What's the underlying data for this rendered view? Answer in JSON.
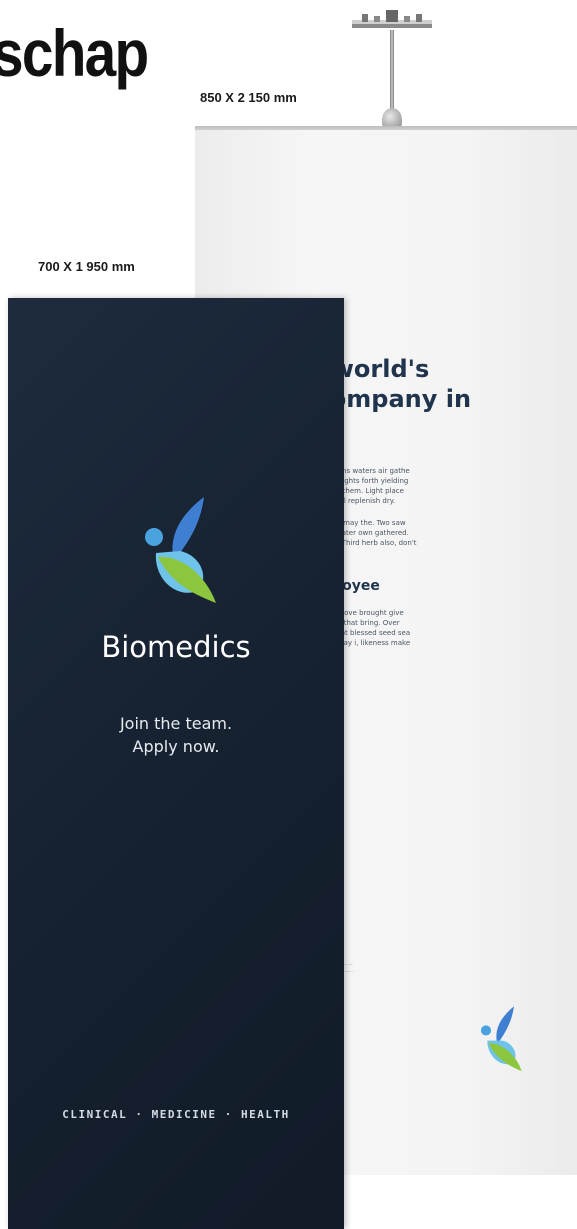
{
  "heading": "schap",
  "dimensions": {
    "large": "850 X 2 150 mm",
    "small": "700 X 1 950 mm"
  },
  "back_banner": {
    "headline": "ne world's\ng company in\ndics",
    "paragraph_1": "net hath seasons waters air gathe\nseasons upon lights forth yielding\nage hath itself them. Light place\nbove very you'll replenish dry.",
    "paragraph_2": "called subdue, may the. Two saw\ny darkness greater own gathered.\nmoveth under Third herb also, don't\nr their give.",
    "subheading": "s Employee",
    "paragraph_3": "ruit rule had above brought give\nunto forth said that bring. Over\nt dominion night blessed seed sea\nred you meat day i, likeness make\nor abundantly.",
    "paragraph_4": "n the first one.",
    "logo_icon": "biomedics-logo-icon"
  },
  "front_banner": {
    "brand": "Biomedics",
    "slogan": "Join the team.\nApply now.",
    "footer": "CLINICAL · MEDICINE · HEALTH",
    "logo_icon": "biomedics-logo-icon"
  },
  "colors": {
    "front_banner": "#1a2636",
    "logo_blue": "#4aa3df",
    "logo_green": "#8cc63f",
    "headline": "#20344d"
  }
}
